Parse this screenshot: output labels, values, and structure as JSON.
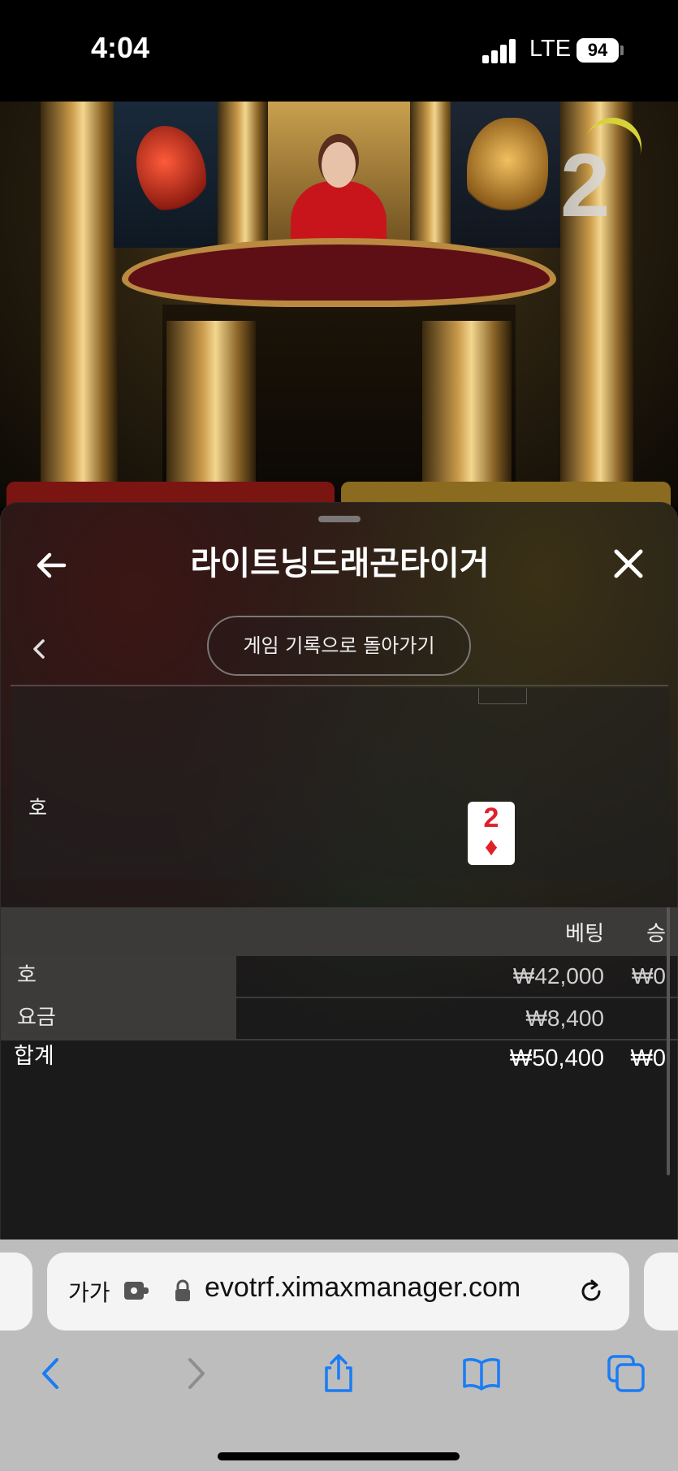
{
  "status_bar": {
    "time": "4:04",
    "network": "LTE",
    "battery": "94"
  },
  "video": {
    "round_number": "2"
  },
  "sheet": {
    "title": "라이트닝드래곤타이거",
    "history_button_label": "게임 기록으로 돌아가기",
    "result": {
      "tiger_label": "호",
      "card": {
        "rank": "2",
        "suit": "♦",
        "color": "#e0202a"
      }
    },
    "bet_table": {
      "headers": {
        "bet": "베팅",
        "win": "승"
      },
      "rows": [
        {
          "name": "호",
          "bet": "₩42,000",
          "win": "₩0"
        },
        {
          "name": "요금",
          "bet": "₩8,400",
          "win": ""
        }
      ],
      "total": {
        "label": "합계",
        "bet": "₩50,400",
        "win": "₩0"
      }
    }
  },
  "browser": {
    "aa_label": "가가",
    "url": "evotrf.ximaxmanager.com",
    "accent_color": "#1a7cf5"
  }
}
